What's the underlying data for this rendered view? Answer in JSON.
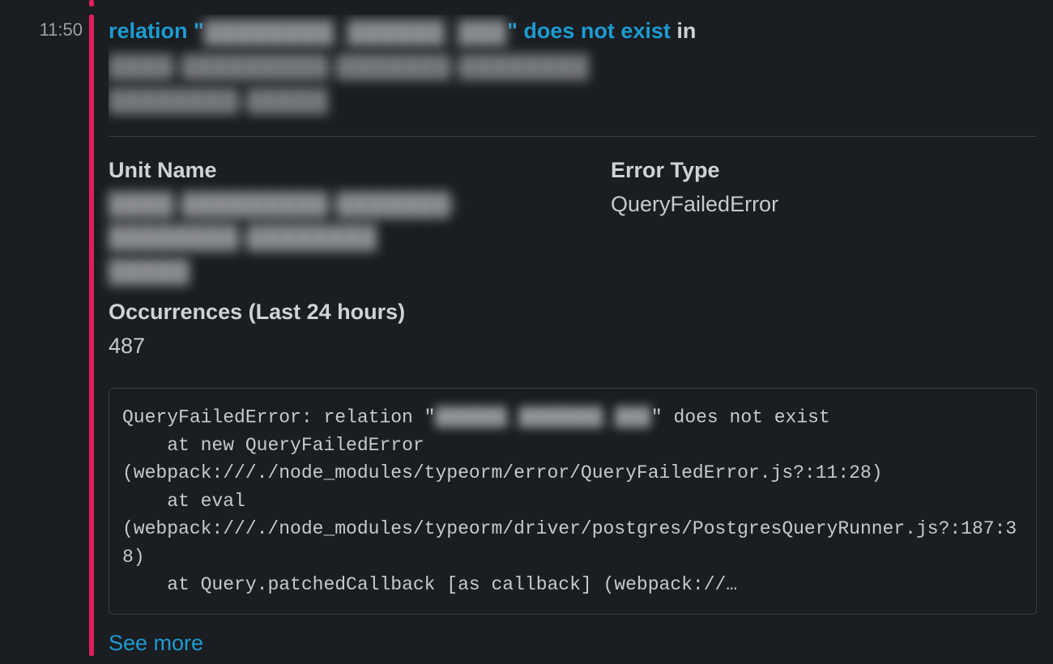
{
  "message": {
    "timestamp": "11:50",
    "title": {
      "link_prefix": "relation \"",
      "link_redacted": "████████_██████_███",
      "link_suffix": "\" does not exist",
      "in_word": " in ",
      "rest_redacted_line1": "████-█████████-███████-████████",
      "rest_redacted_line2": "████████-█████"
    },
    "fields": {
      "unit_name_label": "Unit Name",
      "unit_name_value_line1": "████-█████████-███████-████████-████████",
      "unit_name_value_line2": "█████",
      "error_type_label": "Error Type",
      "error_type_value": "QueryFailedError",
      "occurrences_label": "Occurrences (Last 24 hours)",
      "occurrences_value": "487"
    },
    "code": {
      "line1_pre": "QueryFailedError: relation \"",
      "line1_red": "██████_███████_███",
      "line1_post": "\" does not exist",
      "line2": "    at new QueryFailedError",
      "line3": "(webpack:///./node_modules/typeorm/error/QueryFailedError.js?:11:28)",
      "line4": "    at eval",
      "line5": "(webpack:///./node_modules/typeorm/driver/postgres/PostgresQueryRunner.js?:187:38)",
      "line6": "    at Query.patchedCallback [as callback] (webpack://…"
    },
    "see_more": "See more"
  }
}
